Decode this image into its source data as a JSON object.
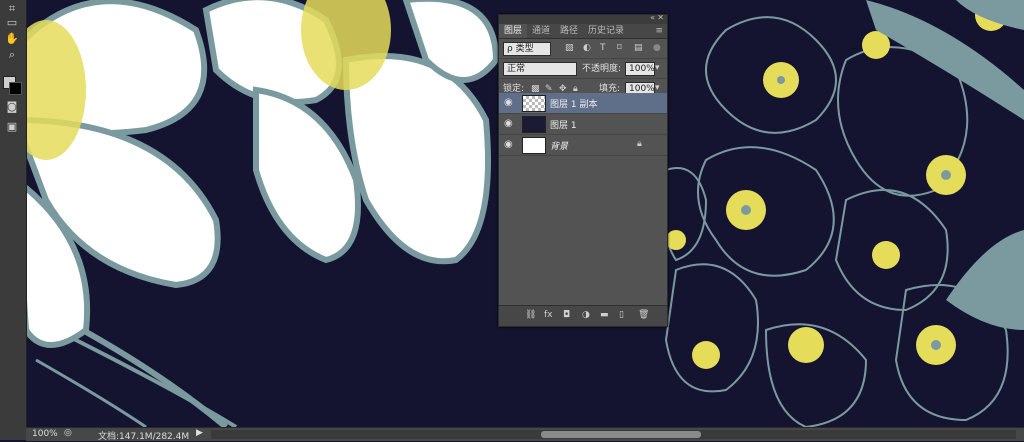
{
  "status_bar": {
    "zoom": "100%",
    "doc_info": "文档:147.1M/282.4M",
    "arrow": "▶"
  },
  "toolbar": {
    "icons": [
      "marquee-icon",
      "lasso-icon",
      "hand-icon",
      "zoom-icon",
      "color-swatch",
      "mask-icon",
      "screen-mode-icon"
    ]
  },
  "layers_panel": {
    "tabs": [
      "图层",
      "通道",
      "路径",
      "历史记录"
    ],
    "active_tab": "图层",
    "filter_kind": "ρ 类型",
    "blend_mode": "正常",
    "opacity_label": "不透明度:",
    "opacity_value": "100%",
    "lock_label": "锁定:",
    "fill_label": "填充:",
    "fill_value": "100%",
    "layers": [
      {
        "name": "图层 1 副本",
        "selected": true,
        "thumb": "check"
      },
      {
        "name": "图层 1",
        "selected": false,
        "thumb": "dark"
      },
      {
        "name": "背景",
        "selected": false,
        "thumb": "white",
        "locked": true
      }
    ]
  },
  "colors": {
    "canvas_bg": "#141430",
    "petal": "#ffffff",
    "outline": "#7a9aa0",
    "pollen": "#e5dc5a",
    "panel_bg": "#535353",
    "selected_layer": "#5f6f8a"
  }
}
